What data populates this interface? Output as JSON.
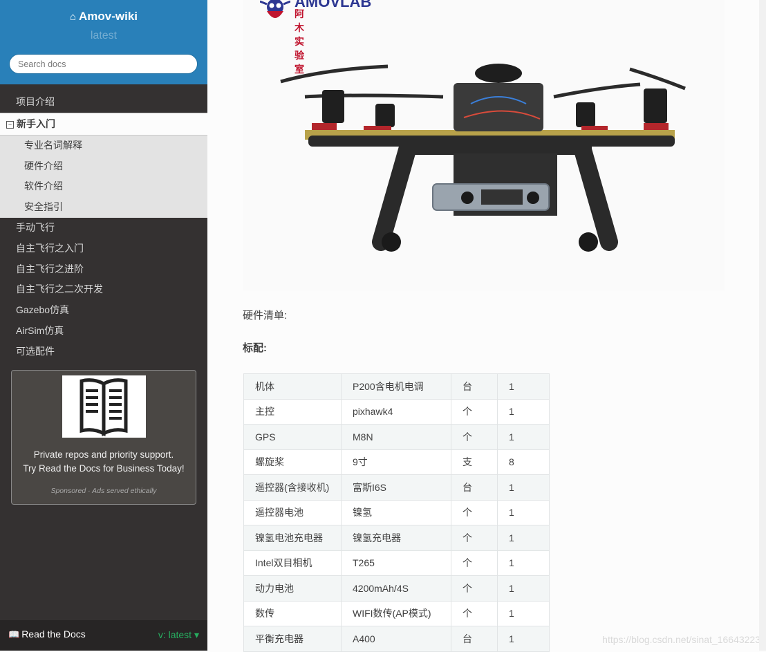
{
  "brand": {
    "title": "Amov-wiki",
    "version": "latest",
    "home_icon": "home-icon"
  },
  "search": {
    "placeholder": "Search docs"
  },
  "nav": {
    "items_top": [
      "项目介绍"
    ],
    "current": {
      "label": "新手入门",
      "toggle": "⊟"
    },
    "subitems": [
      "专业名词解释",
      "硬件介绍",
      "软件介绍",
      "安全指引"
    ],
    "items_bottom": [
      "手动飞行",
      "自主飞行之入门",
      "自主飞行之进阶",
      "自主飞行之二次开发",
      "Gazebo仿真",
      "AirSim仿真",
      "可选配件"
    ]
  },
  "ad": {
    "line1": "Private repos and priority support.",
    "line2": "Try Read the Docs for Business Today!",
    "footer": "Sponsored · Ads served ethically"
  },
  "rtd": {
    "label": "Read the Docs",
    "version": "v: latest ▾"
  },
  "logo": {
    "text": "AMOVLAB",
    "sub": "阿木实验室"
  },
  "content": {
    "hardware_list_label": "硬件清单:",
    "standard_label": "标配:",
    "table": [
      [
        "机体",
        "P200含电机电调",
        "台",
        "1"
      ],
      [
        "主控",
        "pixhawk4",
        "个",
        "1"
      ],
      [
        "GPS",
        "M8N",
        "个",
        "1"
      ],
      [
        "螺旋桨",
        "9寸",
        "支",
        "8"
      ],
      [
        "遥控器(含接收机)",
        "富斯I6S",
        "台",
        "1"
      ],
      [
        "遥控器电池",
        "镍氢",
        "个",
        "1"
      ],
      [
        "镍氢电池充电器",
        "镍氢充电器",
        "个",
        "1"
      ],
      [
        "Intel双目相机",
        "T265",
        "个",
        "1"
      ],
      [
        "动力电池",
        "4200mAh/4S",
        "个",
        "1"
      ],
      [
        "数传",
        "WIFI数传(AP模式)",
        "个",
        "1"
      ],
      [
        "平衡充电器",
        "A400",
        "台",
        "1"
      ]
    ]
  },
  "watermark": "https://blog.csdn.net/sinat_16643223"
}
